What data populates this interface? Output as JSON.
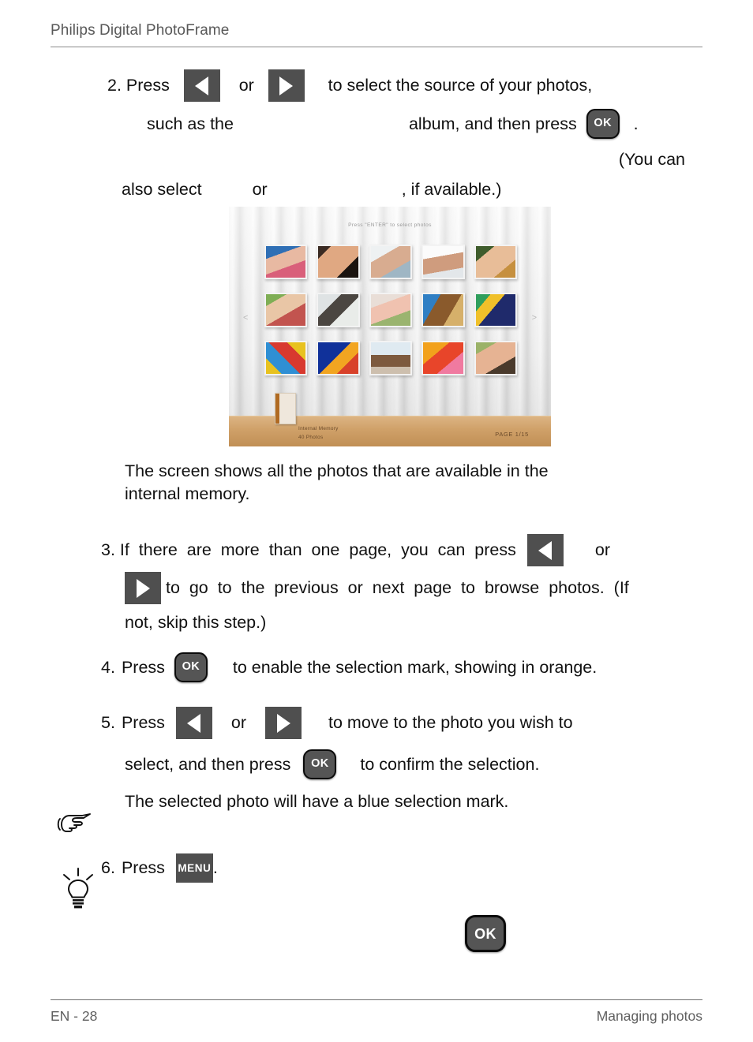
{
  "header": {
    "title": "Philips Digital PhotoFrame"
  },
  "keys": {
    "ok": "OK",
    "menu": "MENU",
    "left_icon": "left-arrow-icon",
    "right_icon": "right-arrow-icon"
  },
  "steps": [
    {
      "number": "2.",
      "lines": [
        {
          "segments": [
            "Press ",
            "[left]",
            "  or ",
            "[right]",
            "    to select the source of your photos,"
          ]
        },
        {
          "segments": [
            "such as the ",
            "[gap-200]",
            " album, and then press ",
            "[ok]",
            "  ."
          ]
        },
        {
          "segments": [
            "[gap-600]",
            "(You can"
          ]
        },
        {
          "segments": [
            "also select ",
            "[gap-60]",
            " or ",
            "[gap-160]",
            ", if available.)"
          ]
        }
      ]
    }
  ],
  "frame": {
    "hint": "Press \"ENTER\" to select  photos",
    "nav_left": "<",
    "nav_right": ">",
    "source_label": "Internal Memory",
    "count_label": "40      Photos",
    "page_label": "PAGE  1/15",
    "thumbnails": [
      {
        "name": "girls-party-hats",
        "css": "linear-gradient(160deg,#2f6fb5 0 28%,#e8b9a2 28% 62%,#d95f7a 62% 100%)"
      },
      {
        "name": "couple-portrait-dark",
        "css": "linear-gradient(135deg,#3a2a22 0 18%,#e0a882 18% 70%,#1b1410 70% 100%)"
      },
      {
        "name": "family-four-light",
        "css": "linear-gradient(150deg,#eef1f2 0 30%,#d8ac90 30% 68%,#9fb6c4 68% 100%)"
      },
      {
        "name": "family-group-white",
        "css": "linear-gradient(170deg,#fbfbfb 0 34%,#cf9c7e 34% 74%,#e3e7ea 74% 100%)"
      },
      {
        "name": "couple-embrace-green",
        "css": "linear-gradient(140deg,#3f5c2c 0 24%,#e8bd98 24% 72%,#c6903f 72% 100%)"
      },
      {
        "name": "kids-outdoors",
        "css": "linear-gradient(150deg,#7fae55 0 22%,#e9c6a6 22% 58%,#c2544f 58% 100%)"
      },
      {
        "name": "boy-with-dog",
        "css": "linear-gradient(135deg,#dfe3e4 0 32%,#4b4641 32% 60%,#e9ece9 60% 100%)"
      },
      {
        "name": "mother-daughter-camera",
        "css": "linear-gradient(160deg,#e9ded7 0 30%,#f0c2b0 30% 66%,#9ab46f 66% 100%)"
      },
      {
        "name": "bird-on-branch",
        "css": "linear-gradient(120deg,#2f7fc4 0 30%,#8a5a2c 30% 66%,#d6b06a 66% 100%)"
      },
      {
        "name": "parrot-rainbow",
        "css": "linear-gradient(130deg,#2f9e5c 0 22%,#f0c02a 22% 44%,#1f2a6b 44% 100%)"
      },
      {
        "name": "colorful-eggs",
        "css": "linear-gradient(45deg,#e8c21f 0 22%,#2f8fd4 22% 48%,#d8392f 48% 74%,#e8c21f 74% 100%)"
      },
      {
        "name": "fireworks-blue",
        "css": "linear-gradient(135deg,#10319a 0 46%,#f2a521 46% 70%,#d8412a 70% 100%)"
      },
      {
        "name": "couple-beach",
        "css": "linear-gradient(180deg,#dfeaf1 0 40%,#7d5a3e 40% 78%,#cdbfae 78% 100%)"
      },
      {
        "name": "orange-flowers",
        "css": "linear-gradient(140deg,#f2a11c 0 34%,#e8452a 34% 66%,#f07aa0 66% 100%)"
      },
      {
        "name": "couple-hug-outdoor",
        "css": "linear-gradient(150deg,#9bb268 0 22%,#e6b393 22% 68%,#4a3a2c 68% 100%)"
      }
    ]
  },
  "note": {
    "screen_text_line1": "The screen shows all the photos that are available in the",
    "screen_text_line2": "internal memory."
  },
  "step3": {
    "number": "3.",
    "line1_before": " If  there  are  more  than  one  page,  you  can  press",
    "line1_after": "or",
    "line2_after": " to  go  to  the  previous  or  next  page  to  browse  photos.  (If",
    "line3": "not, skip this step.)"
  },
  "step4": {
    "number": "4.",
    "press": "Press",
    "after": "to enable the selection mark, showing in orange."
  },
  "step5": {
    "number": "5.",
    "press": "Press",
    "or": "or",
    "after": "to move to the photo you wish to",
    "line2_before": "select, and then press",
    "line2_after": "to confirm the selection.",
    "line3": "The selected photo will have a blue selection mark."
  },
  "step6": {
    "number": "6.",
    "press": "Press",
    "period": "."
  },
  "icons": {
    "pointing_hand": "pointing-hand-icon",
    "lightbulb": "lightbulb-tip-icon"
  },
  "footer": {
    "left": "EN - 28",
    "right": "Managing photos"
  }
}
